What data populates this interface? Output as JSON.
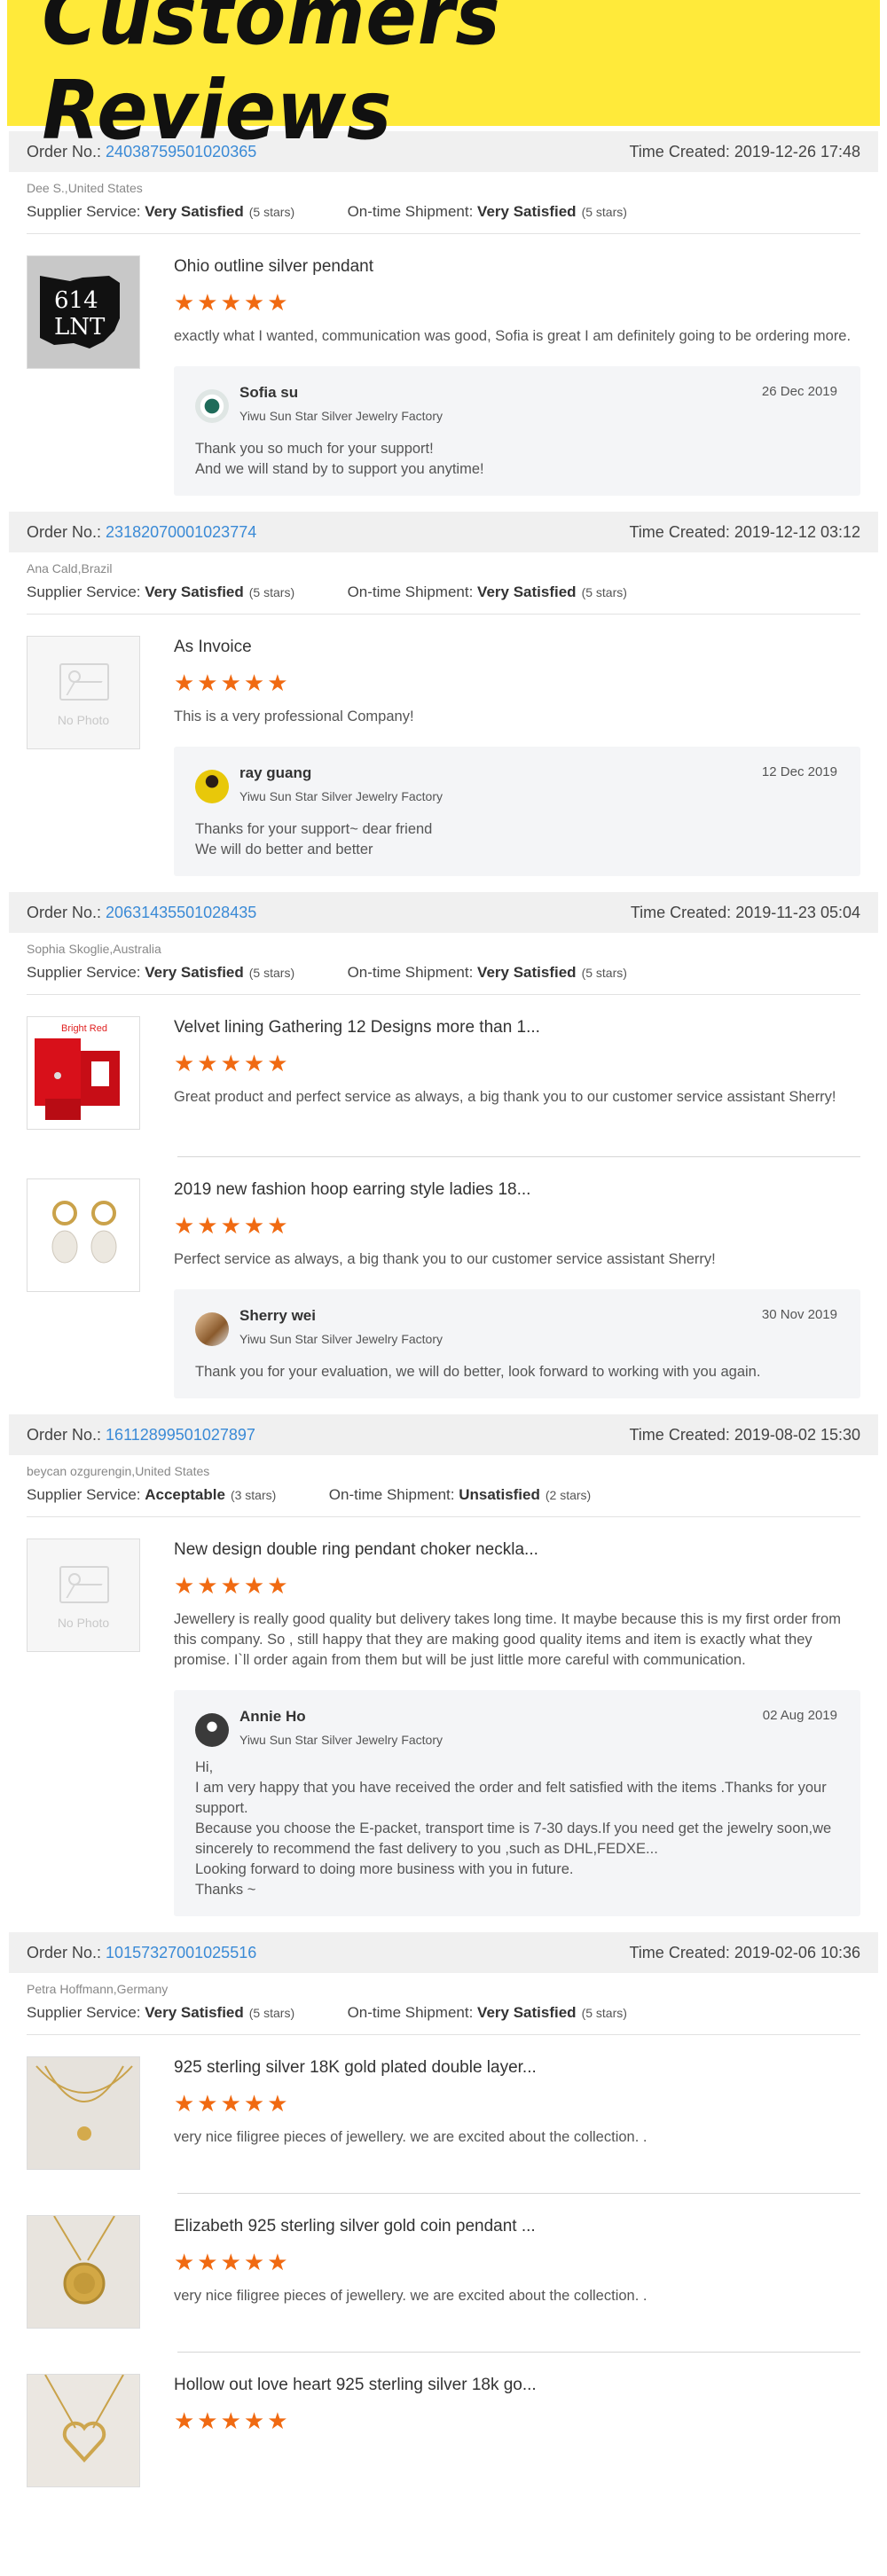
{
  "banner": {
    "title": "Customers Reviews"
  },
  "labels": {
    "order_no": "Order No.:",
    "time_created": "Time Created:",
    "supplier_service": "Supplier Service:",
    "ontime_shipment": "On-time Shipment:",
    "no_photo": "No Photo",
    "stars": "★★★★★"
  },
  "orders": [
    {
      "number": "24038759501020365",
      "time": "2019-12-26 17:48",
      "buyer": "Dee S.,United States",
      "supplier_rating": "Very Satisfied",
      "supplier_stars": "(5 stars)",
      "shipment_rating": "Very Satisfied",
      "shipment_stars": "(5 stars)",
      "items": [
        {
          "title": "Ohio outline silver pendant",
          "thumb_text": "614\nLNT",
          "comment": "exactly what I wanted, communication was good, Sofia is great I am definitely going to be ordering more."
        }
      ],
      "reply": {
        "name": "Sofia su",
        "shop": "Yiwu Sun Star Silver Jewelry Factory",
        "date": "26 Dec 2019",
        "text": "Thank you so much for your support!\nAnd we will stand by to support you anytime!"
      }
    },
    {
      "number": "23182070001023774",
      "time": "2019-12-12 03:12",
      "buyer": "Ana Cald,Brazil",
      "supplier_rating": "Very Satisfied",
      "supplier_stars": "(5 stars)",
      "shipment_rating": "Very Satisfied",
      "shipment_stars": "(5 stars)",
      "items": [
        {
          "title": "As Invoice",
          "comment": "This is a very professional Company!"
        }
      ],
      "reply": {
        "name": "ray guang",
        "shop": "Yiwu Sun Star Silver Jewelry Factory",
        "date": "12 Dec 2019",
        "text": "Thanks for your support~ dear friend\nWe will do better and better"
      }
    },
    {
      "number": "20631435501028435",
      "time": "2019-11-23 05:04",
      "buyer": "Sophia Skoglie,Australia",
      "supplier_rating": "Very Satisfied",
      "supplier_stars": "(5 stars)",
      "shipment_rating": "Very Satisfied",
      "shipment_stars": "(5 stars)",
      "items": [
        {
          "title": "Velvet lining Gathering 12 Designs more than 1...",
          "thumb_text": "Bright Red",
          "comment": "Great product and perfect service as always, a big thank you to our customer service assistant Sherry!"
        },
        {
          "title": "2019 new fashion hoop earring style ladies 18...",
          "comment": "Perfect service as always, a big thank you to our customer service assistant Sherry!"
        }
      ],
      "reply": {
        "name": "Sherry wei",
        "shop": "Yiwu Sun Star Silver Jewelry Factory",
        "date": "30 Nov 2019",
        "text": "Thank you for your evaluation, we will do better, look forward to working with you again."
      }
    },
    {
      "number": "16112899501027897",
      "time": "2019-08-02 15:30",
      "buyer": "beycan ozgurengin,United States",
      "supplier_rating": "Acceptable",
      "supplier_stars": "(3 stars)",
      "shipment_rating": "Unsatisfied",
      "shipment_stars": "(2 stars)",
      "items": [
        {
          "title": "New design double ring pendant choker neckla...",
          "comment": "Jewellery is really good quality but delivery  takes long time.  It maybe because this is my first order from this company. So , still happy that they are making good quality items and item is exactly what they promise. I`ll order again from them  but will be just little more careful with communication."
        }
      ],
      "reply": {
        "name": "Annie Ho",
        "shop": "Yiwu Sun Star Silver Jewelry Factory",
        "date": "02 Aug 2019",
        "text": "Hi,\nI am very happy that you have received the order and felt satisfied with the items .Thanks for your support.\nBecause you choose the E-packet, transport time is 7-30 days.If you need get the jewelry soon,we sincerely to recommend  the fast delivery to you ,such as DHL,FEDXE...\nLooking forward to doing more business with you in future.\nThanks ~"
      }
    },
    {
      "number": "10157327001025516",
      "time": "2019-02-06 10:36",
      "buyer": "Petra Hoffmann,Germany",
      "supplier_rating": "Very Satisfied",
      "supplier_stars": "(5 stars)",
      "shipment_rating": "Very Satisfied",
      "shipment_stars": "(5 stars)",
      "items": [
        {
          "title": "925 sterling silver 18K gold plated double layer...",
          "comment": "very nice filigree pieces of jewellery. we are excited about the collection. ."
        },
        {
          "title": "Elizabeth 925 sterling silver gold coin pendant ...",
          "comment": "very nice filigree pieces of jewellery. we are excited about the collection. ."
        },
        {
          "title": "Hollow out love heart 925 sterling silver 18k go...",
          "comment": ""
        }
      ]
    }
  ]
}
